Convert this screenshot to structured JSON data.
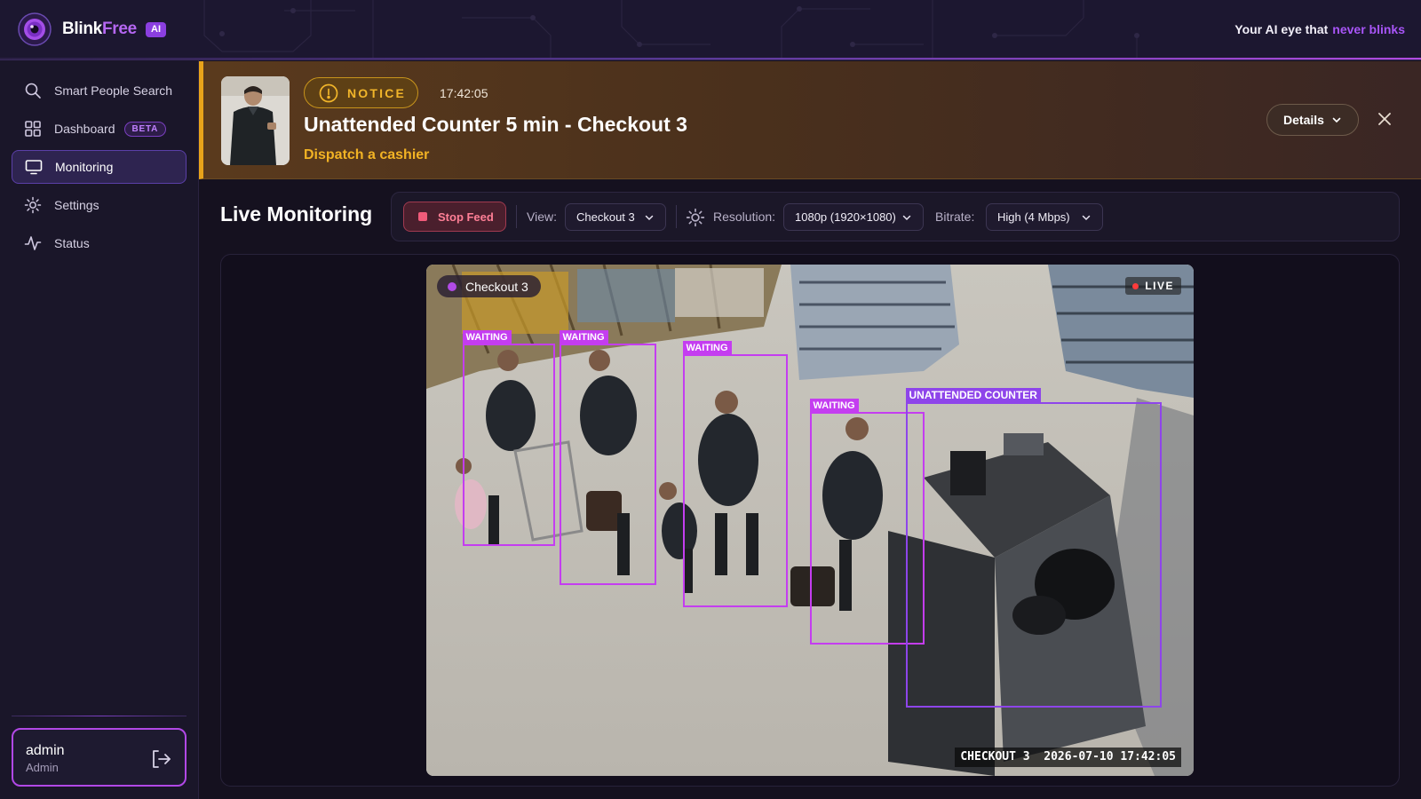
{
  "brand": {
    "name_part1": "Blink",
    "name_part2": "Free",
    "badge": "AI"
  },
  "tagline": {
    "text": "Your AI eye that",
    "accent": "never blinks"
  },
  "sidebar": {
    "items": [
      {
        "label": "Smart People Search",
        "icon": "search-icon"
      },
      {
        "label": "Dashboard",
        "icon": "grid-icon",
        "badge": "BETA"
      },
      {
        "label": "Monitoring",
        "icon": "monitor-icon",
        "active": true
      },
      {
        "label": "Settings",
        "icon": "gear-icon"
      },
      {
        "label": "Status",
        "icon": "activity-icon"
      }
    ],
    "user": {
      "name": "admin",
      "role": "Admin"
    }
  },
  "notice": {
    "level": "NOTICE",
    "time": "17:42:05",
    "title": "Unattended Counter 5 min - Checkout 3",
    "subtitle": "Dispatch a cashier",
    "details_label": "Details"
  },
  "monitoring": {
    "title": "Live Monitoring",
    "stop_label": "Stop Feed",
    "view_label": "View:",
    "view_value": "Checkout 3",
    "resolution_label": "Resolution:",
    "resolution_value": "1080p (1920×1080)",
    "bitrate_label": "Bitrate:",
    "bitrate_value": "High (4 Mbps)"
  },
  "video": {
    "camera_name": "Checkout 3",
    "live_label": "LIVE",
    "osd_camera": "CHECKOUT 3",
    "osd_timestamp": "2026-07-10 17:42:05",
    "detections": [
      {
        "label": "WAITING"
      },
      {
        "label": "WAITING"
      },
      {
        "label": "WAITING"
      },
      {
        "label": "WAITING"
      },
      {
        "label": "UNATTENDED COUNTER"
      }
    ]
  },
  "colors": {
    "accent": "#a855f7",
    "notice": "#f2b324",
    "detection": "#c43df0",
    "counter_detection": "#8e45ea",
    "live": "#ff3b3b"
  }
}
